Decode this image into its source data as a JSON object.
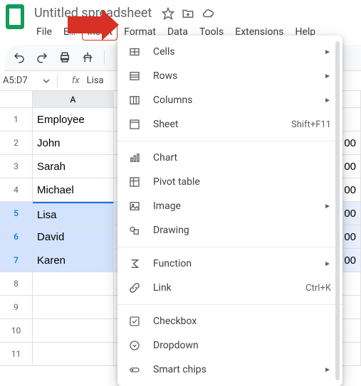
{
  "doc_title": "Untitled spreadsheet",
  "menubar": [
    "File",
    "E…",
    "Insert",
    "Format",
    "Data",
    "Tools",
    "Extensions",
    "Help"
  ],
  "menubar_active_index": 2,
  "name_box": "A5:D7",
  "formula_bar": "Lisa",
  "columns": [
    "A"
  ],
  "rows": [
    {
      "n": "1",
      "a": "Employee",
      "sel": false
    },
    {
      "n": "2",
      "a": "John",
      "sel": false,
      "b": "00"
    },
    {
      "n": "3",
      "a": "Sarah",
      "sel": false,
      "b": "00"
    },
    {
      "n": "4",
      "a": "Michael",
      "sel": false,
      "b": "00"
    },
    {
      "n": "5",
      "a": "Lisa",
      "sel": true,
      "b": "00"
    },
    {
      "n": "6",
      "a": "David",
      "sel": true,
      "b": "00"
    },
    {
      "n": "7",
      "a": "Karen",
      "sel": true,
      "b": "00"
    },
    {
      "n": "8",
      "a": "",
      "sel": false
    },
    {
      "n": "9",
      "a": "",
      "sel": false
    },
    {
      "n": "10",
      "a": "",
      "sel": false
    },
    {
      "n": "11",
      "a": "",
      "sel": false
    }
  ],
  "dropdown": [
    {
      "type": "item",
      "icon": "cells",
      "label": "Cells",
      "sub": "►"
    },
    {
      "type": "item",
      "icon": "rows",
      "label": "Rows",
      "sub": "►"
    },
    {
      "type": "item",
      "icon": "cols",
      "label": "Columns",
      "sub": "►"
    },
    {
      "type": "item",
      "icon": "sheet",
      "label": "Sheet",
      "accel": "Shift+F11"
    },
    {
      "type": "sep"
    },
    {
      "type": "item",
      "icon": "chart",
      "label": "Chart"
    },
    {
      "type": "item",
      "icon": "pivot",
      "label": "Pivot table"
    },
    {
      "type": "item",
      "icon": "image",
      "label": "Image",
      "sub": "►"
    },
    {
      "type": "item",
      "icon": "drawing",
      "label": "Drawing"
    },
    {
      "type": "sep"
    },
    {
      "type": "item",
      "icon": "function",
      "label": "Function",
      "sub": "►"
    },
    {
      "type": "item",
      "icon": "link",
      "label": "Link",
      "accel": "Ctrl+K"
    },
    {
      "type": "sep"
    },
    {
      "type": "item",
      "icon": "checkbox",
      "label": "Checkbox"
    },
    {
      "type": "item",
      "icon": "dropdown",
      "label": "Dropdown"
    },
    {
      "type": "item",
      "icon": "chips",
      "label": "Smart chips",
      "sub": "►"
    }
  ]
}
